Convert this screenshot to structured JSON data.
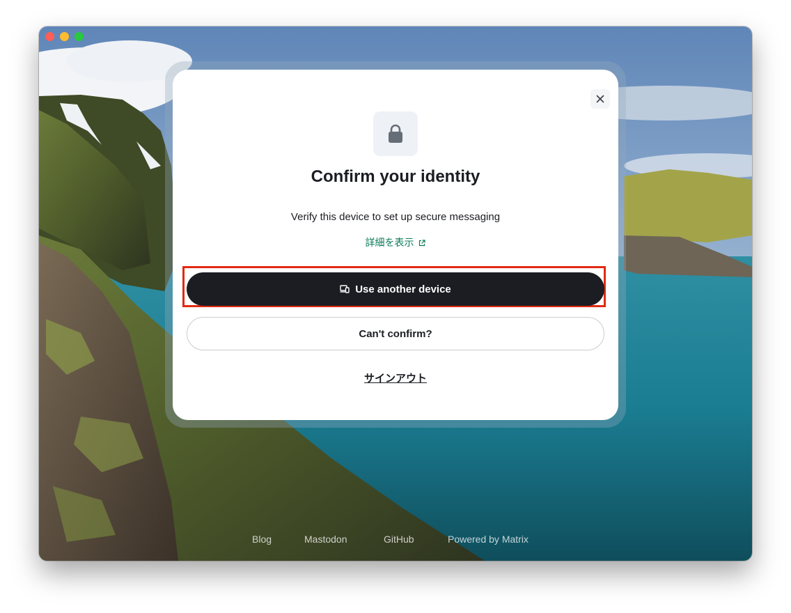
{
  "window": {
    "controls": [
      "close",
      "minimize",
      "zoom"
    ]
  },
  "dialog": {
    "close_icon": "close-icon",
    "header_icon": "lock-icon",
    "title": "Confirm your identity",
    "subtitle": "Verify this device to set up secure messaging",
    "learn_more_label": "詳細を表示",
    "learn_more_icon": "external-link-icon",
    "primary_button": {
      "label": "Use another device",
      "icon": "devices-icon"
    },
    "secondary_button": {
      "label": "Can't confirm?"
    },
    "sign_out_label": "サインアウト"
  },
  "footer": {
    "links": [
      "Blog",
      "Mastodon",
      "GitHub",
      "Powered by Matrix"
    ]
  },
  "colors": {
    "primary_button": "#1b1d22",
    "link": "#0a7a57",
    "highlight": "#e02a12"
  }
}
